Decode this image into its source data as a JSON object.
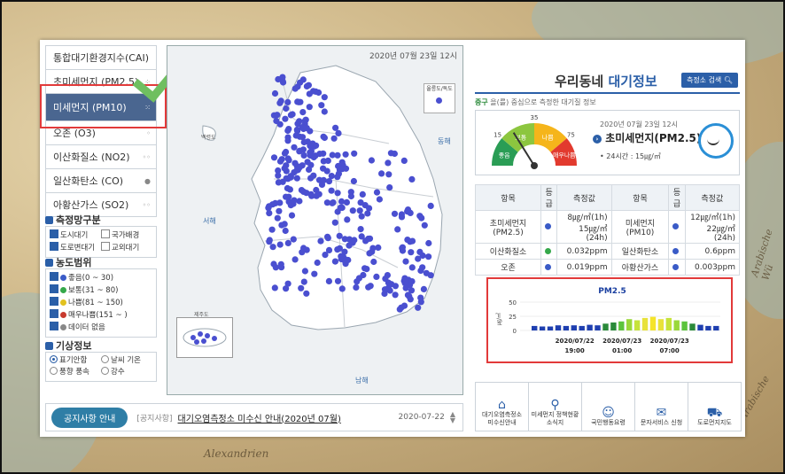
{
  "background_labels": {
    "alexandria": "Alexandrien",
    "arabische": "Arabische Wü",
    "lower": "Arabische"
  },
  "menu": {
    "items": [
      {
        "label": "통합대기환경지수(CAI)"
      },
      {
        "label": "초미세먼지 (PM2.5)"
      },
      {
        "label": "미세먼지 (PM10)"
      },
      {
        "label": "오존 (O3)"
      },
      {
        "label": "이산화질소 (NO2)"
      },
      {
        "label": "일산화탄소 (CO)"
      },
      {
        "label": "아황산가스 (SO2)"
      }
    ]
  },
  "station_types": {
    "title": "측정망구분",
    "options": [
      {
        "label": "도시대기",
        "checked": true
      },
      {
        "label": "국가배경",
        "checked": false
      },
      {
        "label": "도로변대기",
        "checked": true
      },
      {
        "label": "교외대기",
        "checked": false
      }
    ]
  },
  "concentration": {
    "title": "농도범위",
    "levels": [
      {
        "label": "좋음(0 ~ 30)",
        "color": "#3a5bc7"
      },
      {
        "label": "보통(31 ~ 80)",
        "color": "#35a84a"
      },
      {
        "label": "나쁨(81 ~ 150)",
        "color": "#e2c21f"
      },
      {
        "label": "매우나쁨(151 ~ )",
        "color": "#c83a2e"
      },
      {
        "label": "데이터 없음",
        "color": "#888888"
      }
    ]
  },
  "weather": {
    "title": "기상정보",
    "options": [
      {
        "label": "표기안함",
        "selected": true
      },
      {
        "label": "날씨 기온",
        "selected": false
      },
      {
        "label": "풍향 풍속",
        "selected": false
      },
      {
        "label": "강수",
        "selected": false
      }
    ]
  },
  "map": {
    "timestamp": "2020년 07월 23일 12시",
    "legend_mini": "울릉도/독도",
    "labels": {
      "west": "서해",
      "east": "동해",
      "south": "남해",
      "jeju": "제주도",
      "baengnyeong": "백령도"
    },
    "dot_color": "#4a4fd0"
  },
  "notice": {
    "button": "공지사항 안내",
    "category": "[공지사항]",
    "text": "대기오염측정소 미수신 안내(2020년 07월)",
    "date": "2020-07-22"
  },
  "right": {
    "title_plain": "우리동네",
    "title_accent": "대기정보",
    "search_button": "측정소 검색",
    "subtitle_district": "중구",
    "subtitle_rest": "을(를) 중심으로 측정한 대기질 정보",
    "gauge": {
      "ticks": [
        "15",
        "35",
        "75"
      ],
      "zones": [
        "좋음",
        "보통",
        "나쁨",
        "매우\n나쁨"
      ],
      "colors": [
        "#2a9d55",
        "#8cc63f",
        "#f5b51b",
        "#e23a2e"
      ],
      "datetime": "2020년 07월 23일 12시",
      "pollutant": "초미세먼지(PM2.5)",
      "avg24": "• 24시간 : 15㎍/㎥"
    },
    "table": {
      "headers": [
        "항목",
        "등급",
        "측정값",
        "항목",
        "등급",
        "측정값"
      ],
      "rows": [
        {
          "item1": "초미세먼지 (PM2.5)",
          "g1": "#3a5bc7",
          "v1a": "8㎍/㎥(1h)",
          "v1b": "15㎍/㎥(24h)",
          "item2": "미세먼지 (PM10)",
          "g2": "#3a5bc7",
          "v2a": "12㎍/㎥(1h)",
          "v2b": "22㎍/㎥(24h)"
        },
        {
          "item1": "이산화질소",
          "g1": "#35a84a",
          "v1": "0.032ppm",
          "item2": "일산화탄소",
          "g2": "#3a5bc7",
          "v2": "0.6ppm"
        },
        {
          "item1": "오존",
          "g1": "#3a5bc7",
          "v1": "0.019ppm",
          "item2": "아황산가스",
          "g2": "#3a5bc7",
          "v2": "0.003ppm"
        }
      ]
    }
  },
  "chart_data": {
    "type": "bar",
    "title": "PM2.5",
    "ylabel": "㎍/㎥",
    "ylim": [
      0,
      50
    ],
    "yticks": [
      0,
      25,
      50
    ],
    "xtick_labels": [
      [
        "2020/07/22",
        "19:00"
      ],
      [
        "2020/07/23",
        "01:00"
      ],
      [
        "2020/07/23",
        "07:00"
      ]
    ],
    "values": [
      8,
      7,
      7,
      9,
      8,
      9,
      8,
      10,
      9,
      12,
      14,
      16,
      20,
      18,
      22,
      24,
      20,
      22,
      18,
      16,
      12,
      10,
      8,
      8
    ],
    "colors": [
      "#1f3fb0",
      "#1f3fb0",
      "#1f3fb0",
      "#1f3fb0",
      "#1f3fb0",
      "#1f3fb0",
      "#1f3fb0",
      "#1f3fb0",
      "#1f3fb0",
      "#2a8a3a",
      "#2a8a3a",
      "#5cc43d",
      "#9ad83a",
      "#c6e33a",
      "#e8e23a",
      "#f5e42a",
      "#e8e23a",
      "#c6e33a",
      "#9ad83a",
      "#5cc43d",
      "#2a8a3a",
      "#1f3fb0",
      "#1f3fb0",
      "#1f3fb0"
    ]
  },
  "bottom_icons": [
    {
      "label": "대기오염측정소\n미수신안내",
      "icon": "house-icon"
    },
    {
      "label": "미세먼지 정책현황\n소식지",
      "icon": "map-pin-icon"
    },
    {
      "label": "국민행동요령",
      "icon": "person-icon"
    },
    {
      "label": "문자서비스 신청",
      "icon": "phone-icon"
    },
    {
      "label": "도로먼지지도",
      "icon": "car-icon"
    }
  ]
}
